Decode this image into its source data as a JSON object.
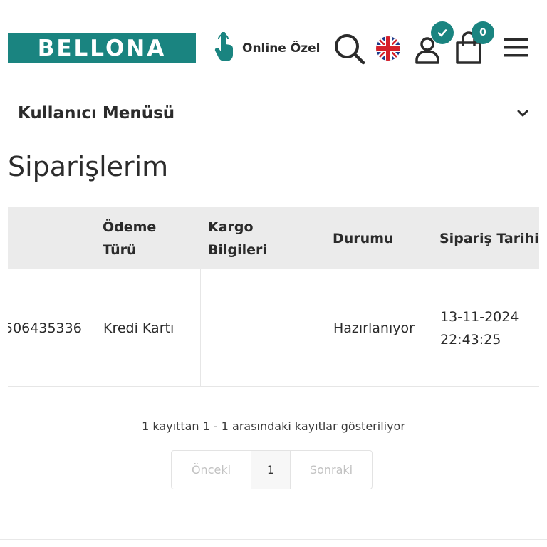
{
  "brand": {
    "logo_text": "BELLONA",
    "accent_color": "#1a8480"
  },
  "header": {
    "promo_label": "Online Özel",
    "icons": [
      "hand-pointer-icon",
      "search-icon",
      "uk-flag-icon",
      "user-icon",
      "shopping-bag-icon",
      "hamburger-menu-icon"
    ],
    "user_badge_icon": "check-icon",
    "cart_count": "0"
  },
  "user_menu": {
    "label": "Kullanıcı Menüsü",
    "icon": "chevron-down-icon"
  },
  "page": {
    "title": "Siparişlerim"
  },
  "orders_table": {
    "columns": [
      "",
      "Ödeme\nTürü",
      "Kargo\nBilgileri",
      "Durumu",
      "Sipariş Tarihi"
    ],
    "rows": [
      {
        "order_no": "506435336",
        "payment": "Kredi Kartı",
        "shipping": "",
        "status": "Hazırlanıyor",
        "date": "13-11-2024",
        "time": "22:43:25"
      }
    ]
  },
  "pagination": {
    "info": "1 kayıttan 1 - 1 arasındaki kayıtlar gösteriliyor",
    "prev_label": "Önceki",
    "current_page": "1",
    "next_label": "Sonraki"
  }
}
